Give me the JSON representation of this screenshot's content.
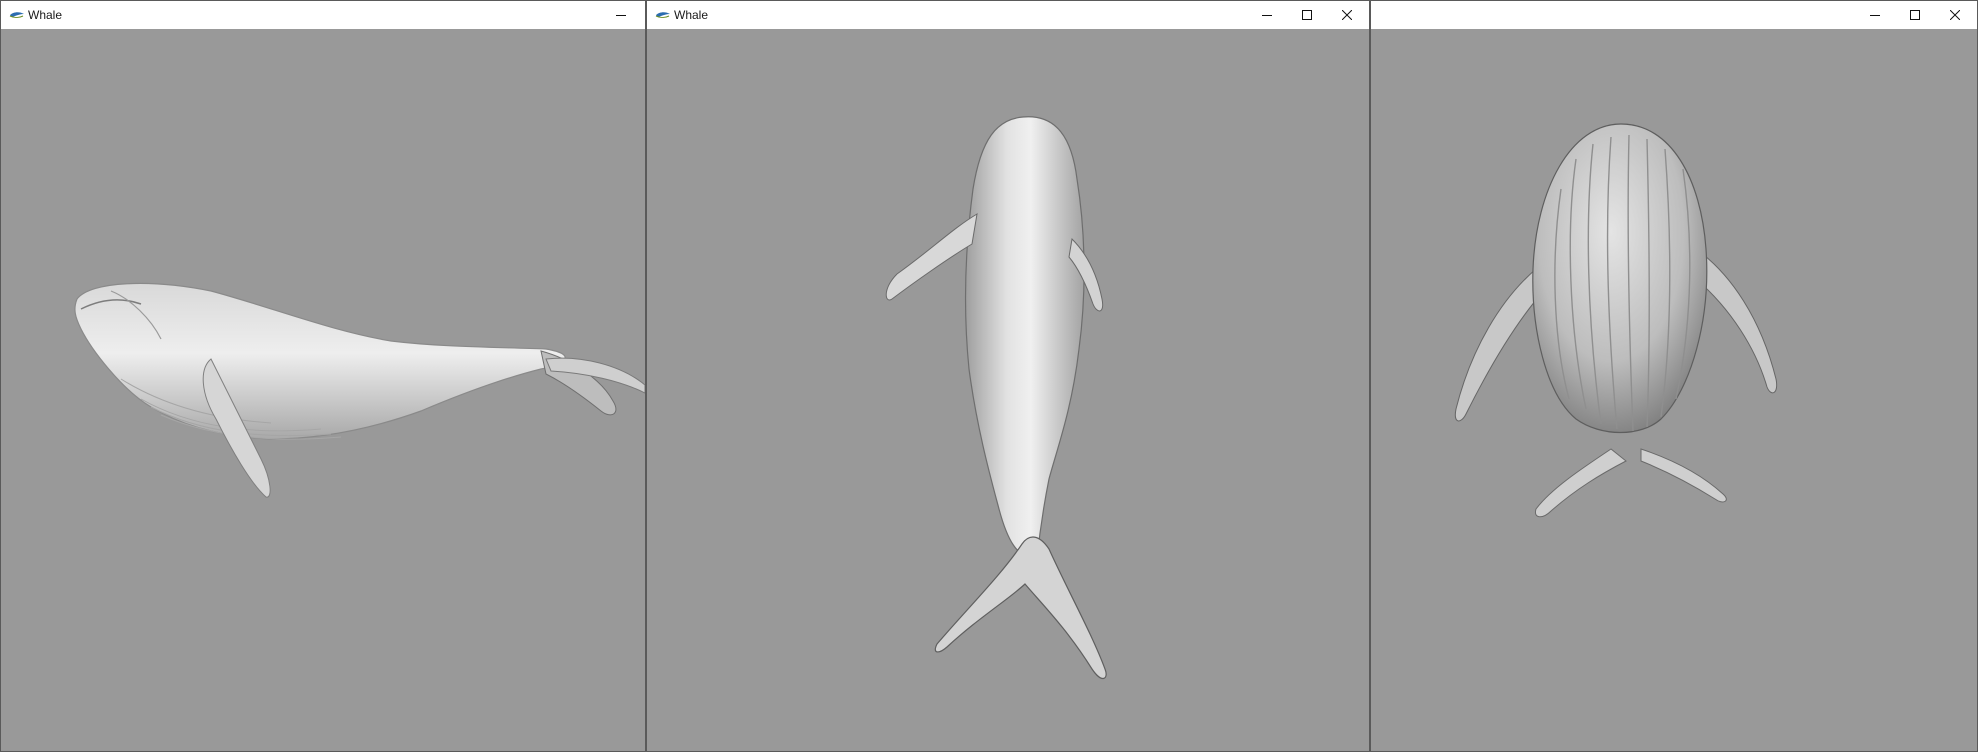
{
  "windows": [
    {
      "title": "Whale",
      "view": "side",
      "controls": [
        "minimize"
      ]
    },
    {
      "title": "Whale",
      "view": "top",
      "controls": [
        "minimize",
        "maximize",
        "close"
      ]
    },
    {
      "title": "",
      "view": "front",
      "controls": [
        "minimize",
        "maximize",
        "close"
      ]
    }
  ],
  "colors": {
    "viewport_background": "#999999",
    "titlebar_background": "#ffffff",
    "whale_highlight": "#e6e6e6",
    "whale_shadow": "#7d7d7d"
  },
  "icons": {
    "app": "whale-app-icon",
    "minimize": "minimize-icon",
    "maximize": "maximize-icon",
    "close": "close-icon"
  }
}
